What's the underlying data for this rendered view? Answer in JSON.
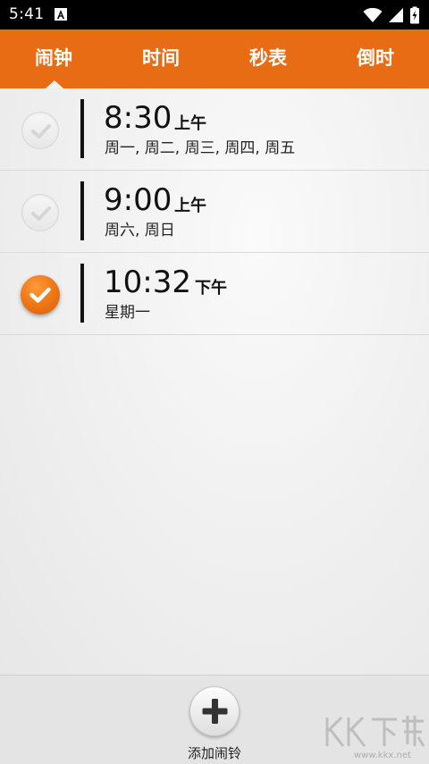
{
  "status_bar": {
    "time": "5:41",
    "icons": [
      "notification-a-icon",
      "wifi-icon",
      "cell-signal-icon",
      "battery-icon"
    ]
  },
  "tabs": [
    {
      "label": "闹钟",
      "selected": true
    },
    {
      "label": "时间",
      "selected": false
    },
    {
      "label": "秒表",
      "selected": false
    },
    {
      "label": "倒时",
      "selected": false
    }
  ],
  "alarms": [
    {
      "time": "8:30",
      "ampm": "上午",
      "days": "周一, 周二, 周三, 周四, 周五",
      "enabled": false
    },
    {
      "time": "9:00",
      "ampm": "上午",
      "days": "周六, 周日",
      "enabled": false
    },
    {
      "time": "10:32",
      "ampm": "下午",
      "days": "星期一",
      "enabled": true
    }
  ],
  "bottom": {
    "add_label": "添加闹铃"
  },
  "colors": {
    "accent": "#e86c13",
    "check_on": "#f07a18"
  }
}
